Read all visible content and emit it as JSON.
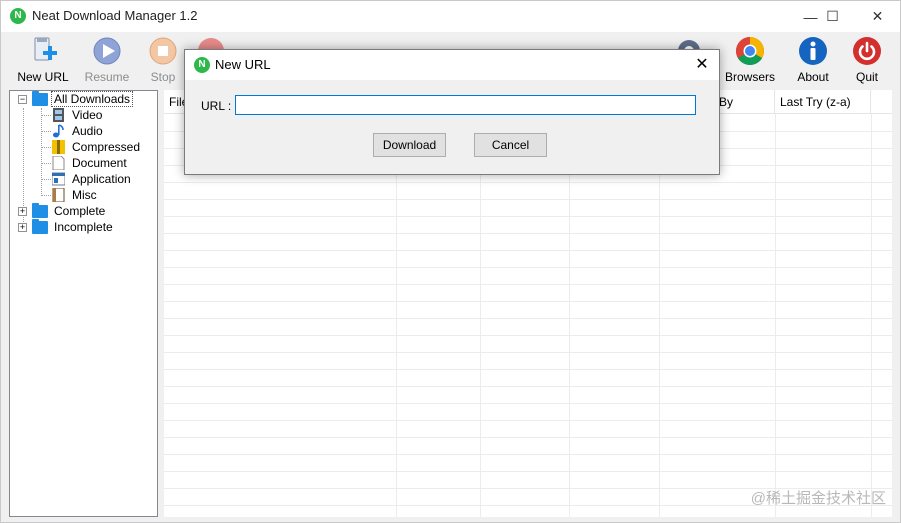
{
  "window": {
    "title": "Neat Download Manager 1.2",
    "logo_letter": "N",
    "controls": {
      "minimize": "—",
      "maximize": "☐",
      "close": "✕"
    }
  },
  "toolbar": {
    "new_url": "New URL",
    "resume": "Resume",
    "stop": "Stop",
    "browsers": "Browsers",
    "about": "About",
    "quit": "Quit"
  },
  "tree": {
    "all_downloads": "All Downloads",
    "video": "Video",
    "audio": "Audio",
    "compressed": "Compressed",
    "document": "Document",
    "application": "Application",
    "misc": "Misc",
    "complete": "Complete",
    "incomplete": "Incomplete",
    "expander_minus": "−",
    "expander_plus": "+"
  },
  "list": {
    "columns": [
      "File",
      "By",
      "Last Try (z-a)"
    ]
  },
  "dialog": {
    "title": "New URL",
    "logo_letter": "N",
    "close": "✕",
    "url_label": "URL :",
    "url_value": "",
    "download_button": "Download",
    "cancel_button": "Cancel"
  },
  "watermark": "@稀土掘金技术社区",
  "colors": {
    "accent": "#0078d7",
    "folder": "#1f8fe6",
    "logo_green": "#2eb84b"
  }
}
